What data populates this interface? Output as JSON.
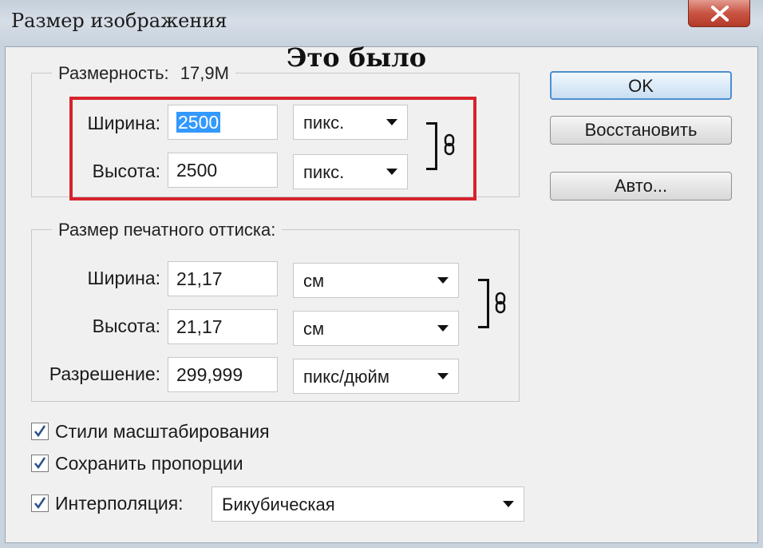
{
  "window": {
    "title": "Размер изображения"
  },
  "caption": "Это было",
  "pixel_dims": {
    "label": "Размерность:",
    "size": "17,9M",
    "width": {
      "label": "Ширина:",
      "value": "2500",
      "unit": "пикс."
    },
    "height": {
      "label": "Высота:",
      "value": "2500",
      "unit": "пикс."
    }
  },
  "print_size": {
    "label": "Размер печатного оттиска:",
    "width": {
      "label": "Ширина:",
      "value": "21,17",
      "unit": "см"
    },
    "height": {
      "label": "Высота:",
      "value": "21,17",
      "unit": "см"
    },
    "resolution": {
      "label": "Разрешение:",
      "value": "299,999",
      "unit": "пикс/дюйм"
    }
  },
  "options": {
    "scale_styles": {
      "label": "Стили масштабирования",
      "checked": true
    },
    "constrain": {
      "label": "Сохранить пропорции",
      "checked": true
    },
    "resample": {
      "label": "Интерполяция:",
      "checked": true,
      "value": "Бикубическая"
    }
  },
  "buttons": {
    "ok": "OK",
    "reset": "Восстановить",
    "auto": "Авто..."
  },
  "icons": {
    "close": "close-icon",
    "chain": "chain-link-icon",
    "check": "checkmark-icon"
  },
  "colors": {
    "highlight_frame": "#d6232b",
    "selection": "#3399ff",
    "close_button": "#c95443"
  }
}
